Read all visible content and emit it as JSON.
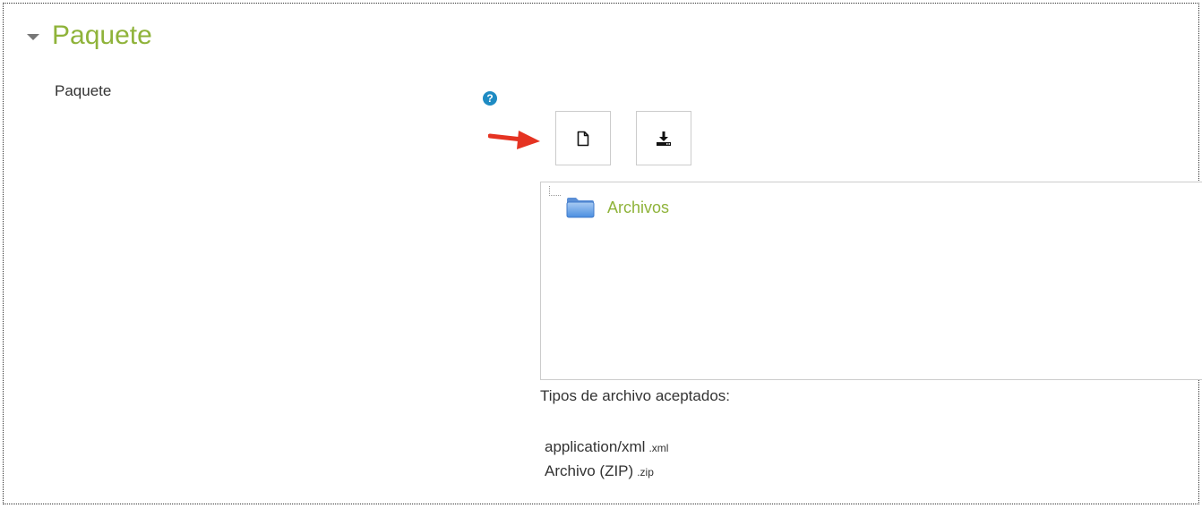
{
  "section": {
    "title": "Paquete",
    "expanded": true
  },
  "field": {
    "label": "Paquete",
    "help_icon": "question-circle-icon"
  },
  "toolbar": {
    "add_file_icon": "file-icon",
    "download_icon": "download-icon"
  },
  "annotation": {
    "icon": "red-arrow-icon",
    "color": "#e53322"
  },
  "filemanager": {
    "folder": {
      "label": "Archivos",
      "icon": "folder-icon"
    }
  },
  "accepted": {
    "title": "Tipos de archivo aceptados:",
    "types": [
      {
        "name": "application/xml",
        "ext": ".xml"
      },
      {
        "name": "Archivo (ZIP)",
        "ext": ".zip"
      }
    ]
  },
  "colors": {
    "accent": "#8fb33a",
    "help": "#1e8bc3",
    "border": "#cccccc"
  }
}
